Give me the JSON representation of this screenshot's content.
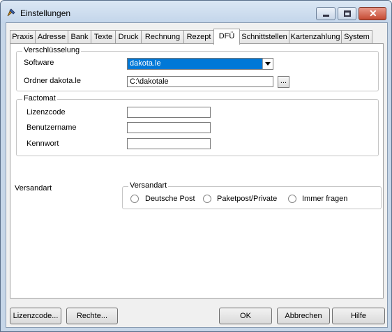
{
  "window": {
    "title": "Einstellungen"
  },
  "tabs": [
    "Praxis",
    "Adresse",
    "Bank",
    "Texte",
    "Druck",
    "Rechnung",
    "Rezept",
    "DFÜ",
    "Schnittstellen",
    "Kartenzahlung",
    "System"
  ],
  "active_tab": "DFÜ",
  "verschluesselung": {
    "title": "Verschlüsselung",
    "software_label": "Software",
    "software_value": "dakota.le",
    "ordner_label": "Ordner dakota.le",
    "ordner_value": "C:\\dakotale",
    "browse_label": "..."
  },
  "factomat": {
    "title": "Factomat",
    "lizenzcode_label": "Lizenzcode",
    "benutzername_label": "Benutzername",
    "kennwort_label": "Kennwort",
    "lizenzcode_value": "",
    "benutzername_value": "",
    "kennwort_value": ""
  },
  "versandart": {
    "outer_label": "Versandart",
    "group_title": "Versandart",
    "options": [
      "Deutsche Post",
      "Paketpost/Private",
      "Immer fragen"
    ]
  },
  "buttons": {
    "lizenzcode": "Lizenzcode...",
    "rechte": "Rechte...",
    "ok": "OK",
    "abbrechen": "Abbrechen",
    "hilfe": "Hilfe"
  },
  "colors": {
    "selection": "#0078d7",
    "titlebar": "#c3d5ea"
  }
}
